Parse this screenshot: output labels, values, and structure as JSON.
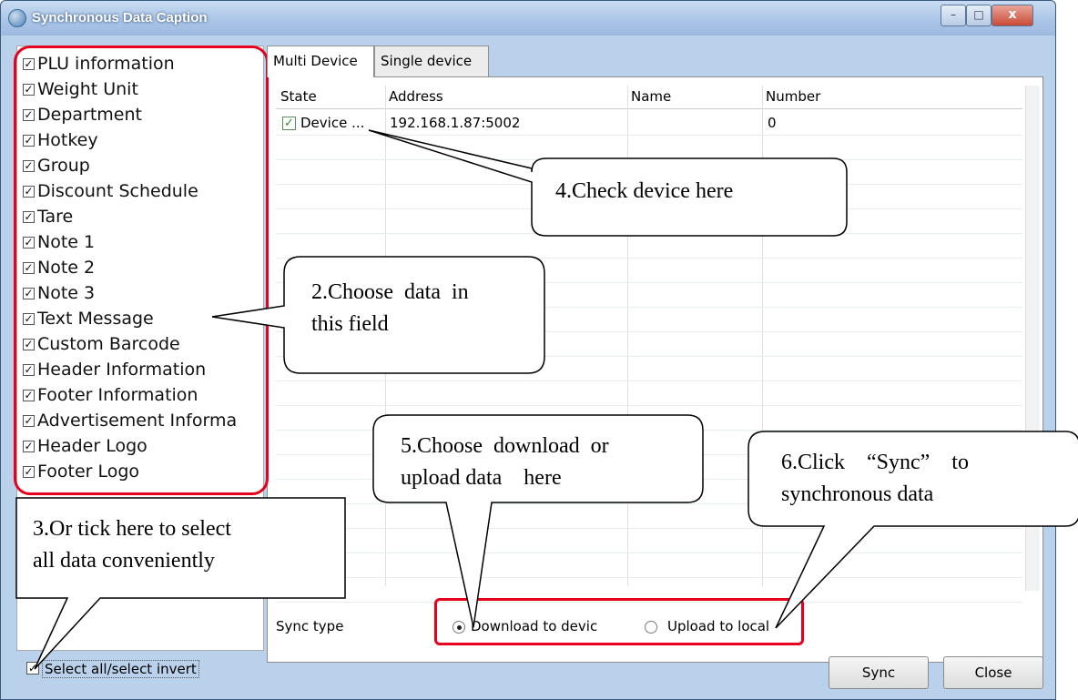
{
  "window": {
    "title": "Synchronous Data Caption",
    "minimize": "–",
    "maximize": "□",
    "close": "x"
  },
  "data_items": [
    "PLU information",
    "Weight Unit",
    "Department",
    "Hotkey",
    "Group",
    "Discount Schedule",
    "Tare",
    "Note 1",
    "Note 2",
    "Note 3",
    "Text Message",
    "Custom Barcode",
    "Header Information",
    "Footer Information",
    "Advertisement Informa",
    "Header Logo",
    "Footer Logo"
  ],
  "tabs": {
    "multi": "Multi Device",
    "single": "Single device"
  },
  "grid": {
    "headers": {
      "state": "State",
      "address": "Address",
      "name": "Name",
      "number": "Number"
    },
    "row": {
      "state": "Device ...",
      "address": "192.168.1.87:5002",
      "name": "",
      "number": "0"
    }
  },
  "sync": {
    "label": "Sync type",
    "download": "Download to devic",
    "upload": "Upload to local"
  },
  "select_all": "Select all/select invert",
  "buttons": {
    "sync": "Sync",
    "close": "Close"
  },
  "callouts": {
    "c2_line1": "2.Choose  data  in",
    "c2_line2": "this field",
    "c3_line1": "3.Or tick here to select",
    "c3_line2": "all data conveniently",
    "c4": "4.Check device here",
    "c5_line1": "5.Choose  download  or",
    "c5_line2": "upload data    here",
    "c6_line1": "6.Click    “Sync”    to",
    "c6_line2": "synchronous data"
  },
  "colors": {
    "accent_red": "#e6001e",
    "title_bar": "#a9c4e6",
    "check_green": "#2e8b2e"
  }
}
